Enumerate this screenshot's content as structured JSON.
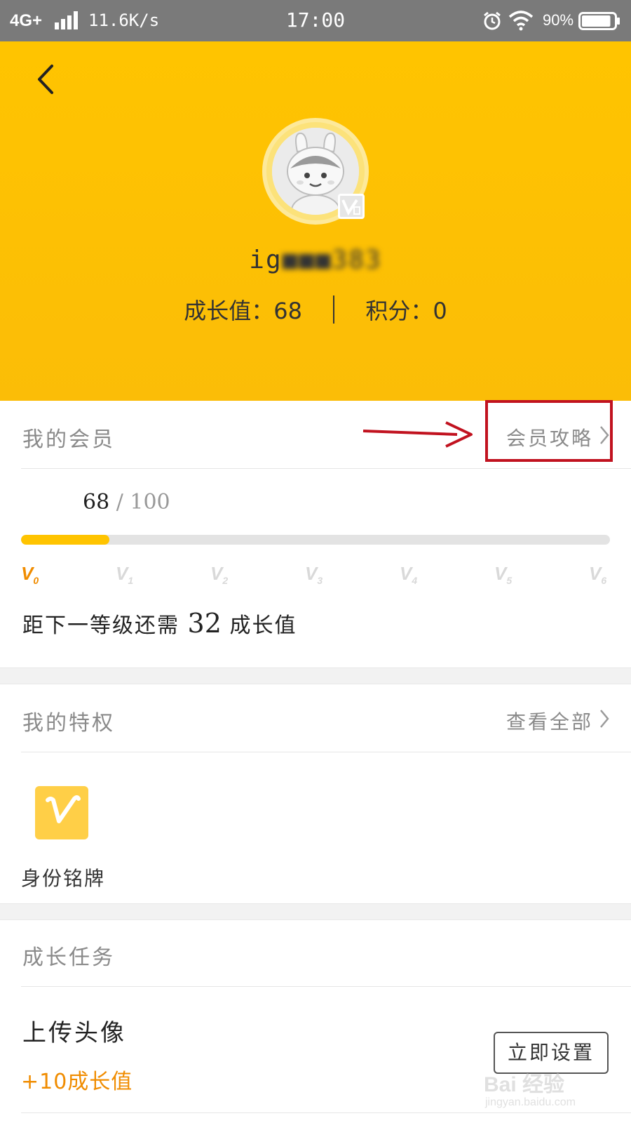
{
  "status_bar": {
    "network": "4G+",
    "speed": "11.6K/s",
    "time": "17:00",
    "battery_percent": "90%",
    "battery_level": 0.9,
    "icons": [
      "signal-icon",
      "alarm-icon",
      "wifi-icon",
      "battery-icon"
    ]
  },
  "header": {
    "username_visible": "ig",
    "username_blurred": "■■■383",
    "growth": {
      "label": "成长值：",
      "value": "68"
    },
    "points": {
      "label": "积分：",
      "value": "0"
    },
    "avatar_badge_level": "V0",
    "background_color": "#ffc400"
  },
  "membership": {
    "title": "我的会员",
    "link": "会员攻略",
    "progress": {
      "current": "68",
      "separator": " / ",
      "total": "100",
      "fraction": 0.68
    },
    "levels": [
      {
        "v": "V",
        "n": "0",
        "active": true
      },
      {
        "v": "V",
        "n": "1",
        "active": false
      },
      {
        "v": "V",
        "n": "2",
        "active": false
      },
      {
        "v": "V",
        "n": "3",
        "active": false
      },
      {
        "v": "V",
        "n": "4",
        "active": false
      },
      {
        "v": "V",
        "n": "5",
        "active": false
      },
      {
        "v": "V",
        "n": "6",
        "active": false
      }
    ],
    "next_level": {
      "prefix": "距下一等级还需",
      "value": "32",
      "suffix": "成长值"
    }
  },
  "privileges": {
    "title": "我的特权",
    "link": "查看全部",
    "items": [
      {
        "label": "身份铭牌",
        "icon": "v-badge-icon"
      }
    ]
  },
  "tasks": {
    "title": "成长任务",
    "items": [
      {
        "title": "上传头像",
        "reward": "+10成长值",
        "button": "立即设置"
      }
    ]
  },
  "watermark": {
    "main": "Bai 经验",
    "sub": "jingyan.baidu.com"
  },
  "colors": {
    "accent": "#ffc400",
    "reward": "#f08c00",
    "annotation": "#c1121f"
  }
}
